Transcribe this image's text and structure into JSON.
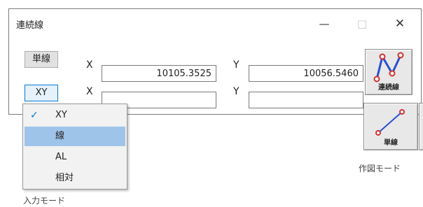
{
  "window": {
    "title": "連続線",
    "minimize": "—",
    "maximize": "□",
    "close": "✕"
  },
  "mode_button": {
    "label": "単線"
  },
  "input_mode_button": {
    "label": "XY"
  },
  "row1": {
    "x_label": "X",
    "x_value": "10105.3525",
    "y_label": "Y",
    "y_value": "10056.5460"
  },
  "row2": {
    "x_label": "X",
    "x_value": "",
    "y_label": "Y",
    "y_value": ""
  },
  "draw_tools": {
    "continuous": "連続線",
    "single": "単線"
  },
  "input_menu": {
    "check": "✓",
    "items": [
      "XY",
      "線",
      "AL",
      "相対"
    ],
    "checked": "XY",
    "highlighted": "線"
  },
  "captions": {
    "draw_mode": "作図モード",
    "input_mode": "入力モード"
  }
}
